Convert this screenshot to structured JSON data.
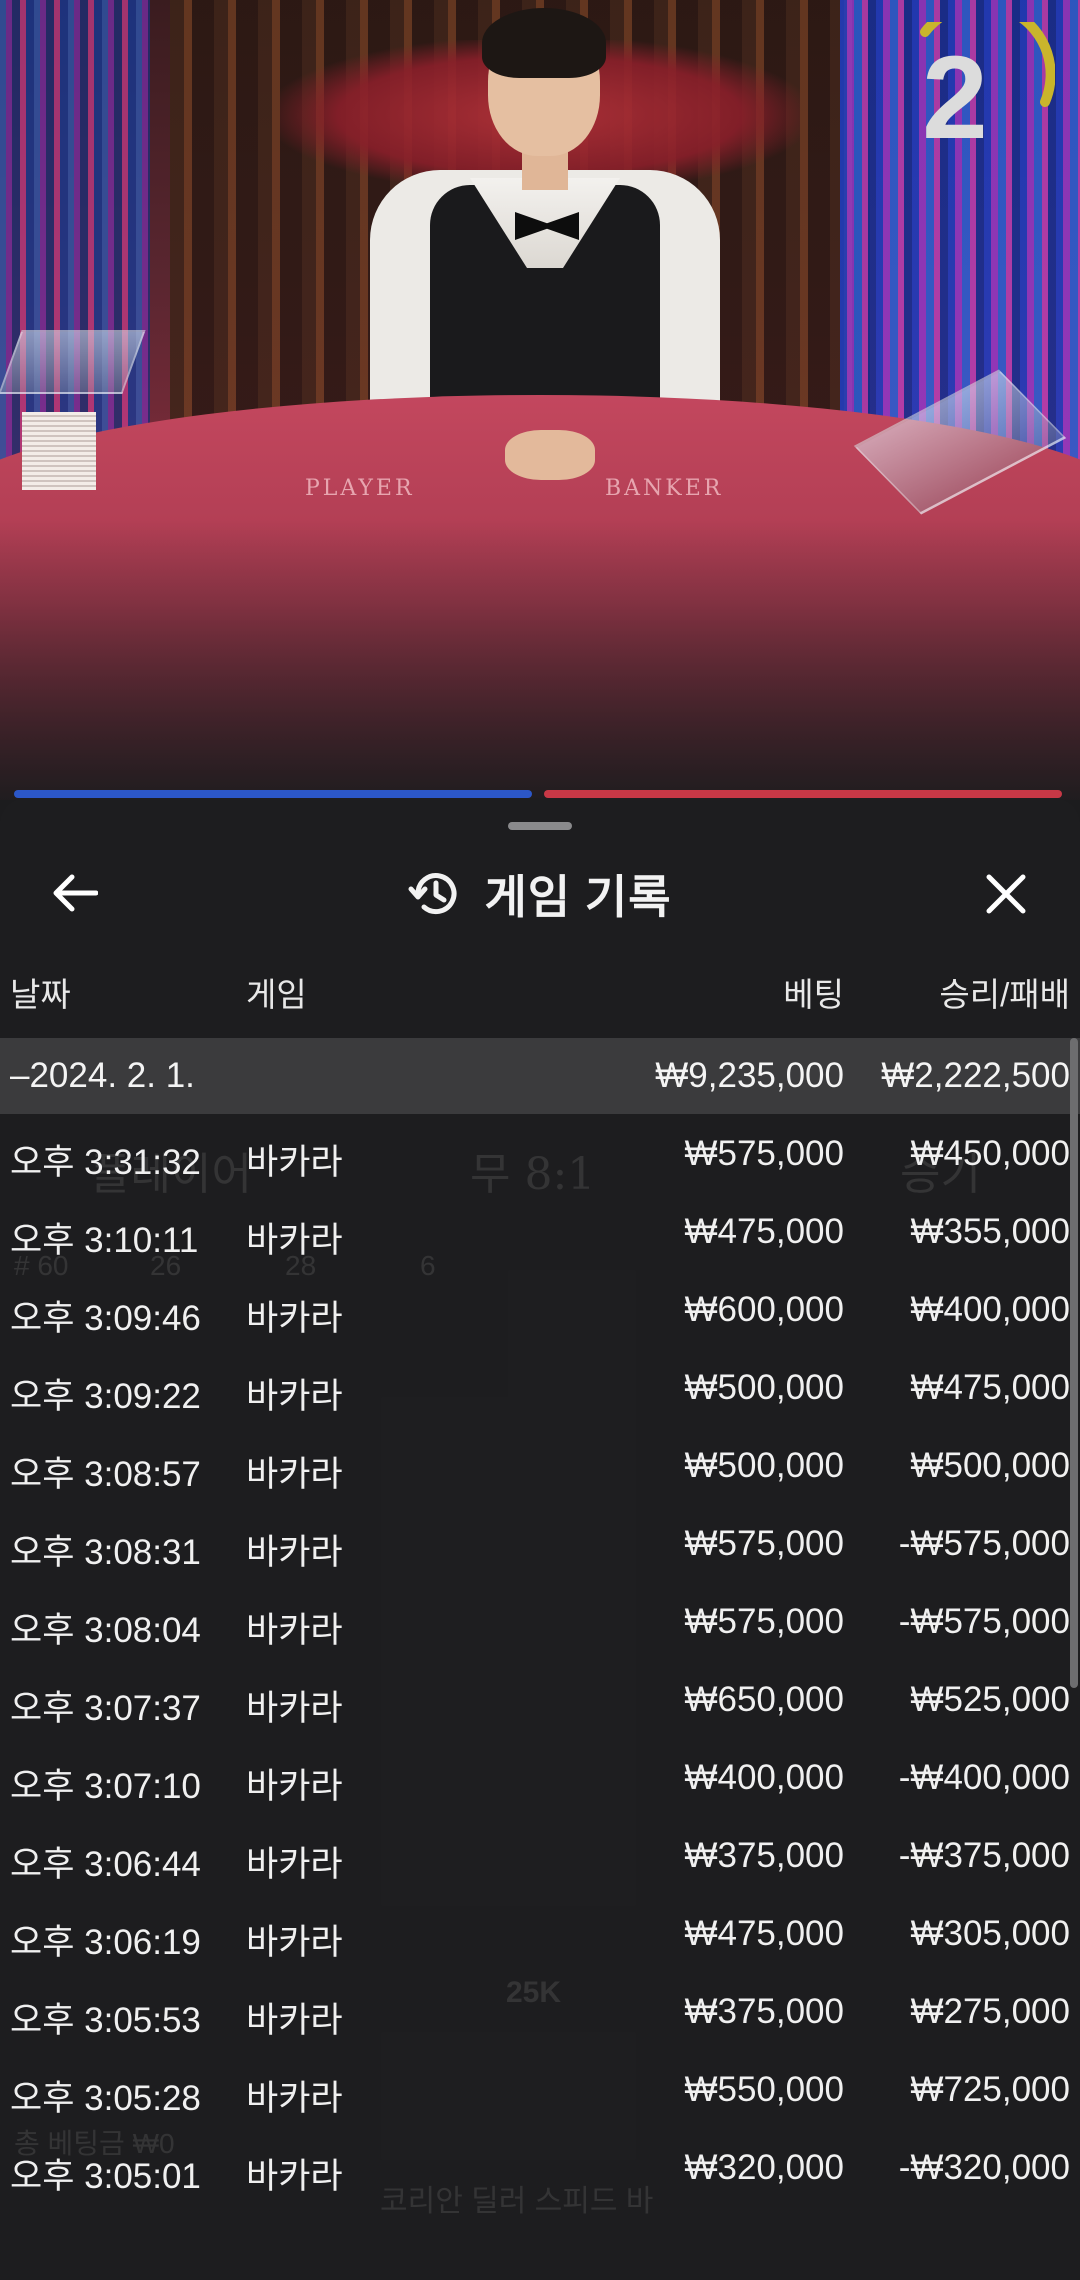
{
  "video": {
    "countdown": "2",
    "table_labels": {
      "player": "PLAYER",
      "banker": "BANKER"
    }
  },
  "colors": {
    "player_blue": "#2c57c8",
    "banker_red": "#c83846",
    "sheet_bg": "#1e1e20",
    "group_row_bg": "#3b3b3d"
  },
  "background_ui": {
    "player_label": "플레이어",
    "tie_label": "무 8:1",
    "banker_label": "승기",
    "stats": {
      "total": "# 60",
      "player": "26",
      "banker": "28",
      "tie": "6"
    },
    "chip": "25K",
    "total_bet": "총 베팅금 ₩0",
    "table_name": "코리안 딜러 스피드 바"
  },
  "sheet": {
    "title": "게임 기록",
    "icons": {
      "back": "arrow-left-icon",
      "history": "history-clock-icon",
      "close": "close-icon"
    },
    "columns": {
      "date": "날짜",
      "game": "게임",
      "bet": "베팅",
      "win_loss": "승리/패배"
    },
    "group": {
      "date": "–2024. 2. 1.",
      "bet_total": "₩9,235,000",
      "win_total": "₩2,222,500"
    },
    "rows": [
      {
        "time": "오후 3:31:32",
        "game": "바카라",
        "bet": "₩575,000",
        "win": "₩450,000"
      },
      {
        "time": "오후 3:10:11",
        "game": "바카라",
        "bet": "₩475,000",
        "win": "₩355,000"
      },
      {
        "time": "오후 3:09:46",
        "game": "바카라",
        "bet": "₩600,000",
        "win": "₩400,000"
      },
      {
        "time": "오후 3:09:22",
        "game": "바카라",
        "bet": "₩500,000",
        "win": "₩475,000"
      },
      {
        "time": "오후 3:08:57",
        "game": "바카라",
        "bet": "₩500,000",
        "win": "₩500,000"
      },
      {
        "time": "오후 3:08:31",
        "game": "바카라",
        "bet": "₩575,000",
        "win": "-₩575,000"
      },
      {
        "time": "오후 3:08:04",
        "game": "바카라",
        "bet": "₩575,000",
        "win": "-₩575,000"
      },
      {
        "time": "오후 3:07:37",
        "game": "바카라",
        "bet": "₩650,000",
        "win": "₩525,000"
      },
      {
        "time": "오후 3:07:10",
        "game": "바카라",
        "bet": "₩400,000",
        "win": "-₩400,000"
      },
      {
        "time": "오후 3:06:44",
        "game": "바카라",
        "bet": "₩375,000",
        "win": "-₩375,000"
      },
      {
        "time": "오후 3:06:19",
        "game": "바카라",
        "bet": "₩475,000",
        "win": "₩305,000"
      },
      {
        "time": "오후 3:05:53",
        "game": "바카라",
        "bet": "₩375,000",
        "win": "₩275,000"
      },
      {
        "time": "오후 3:05:28",
        "game": "바카라",
        "bet": "₩550,000",
        "win": "₩725,000"
      },
      {
        "time": "오후 3:05:01",
        "game": "바카라",
        "bet": "₩320,000",
        "win": "-₩320,000"
      }
    ]
  }
}
